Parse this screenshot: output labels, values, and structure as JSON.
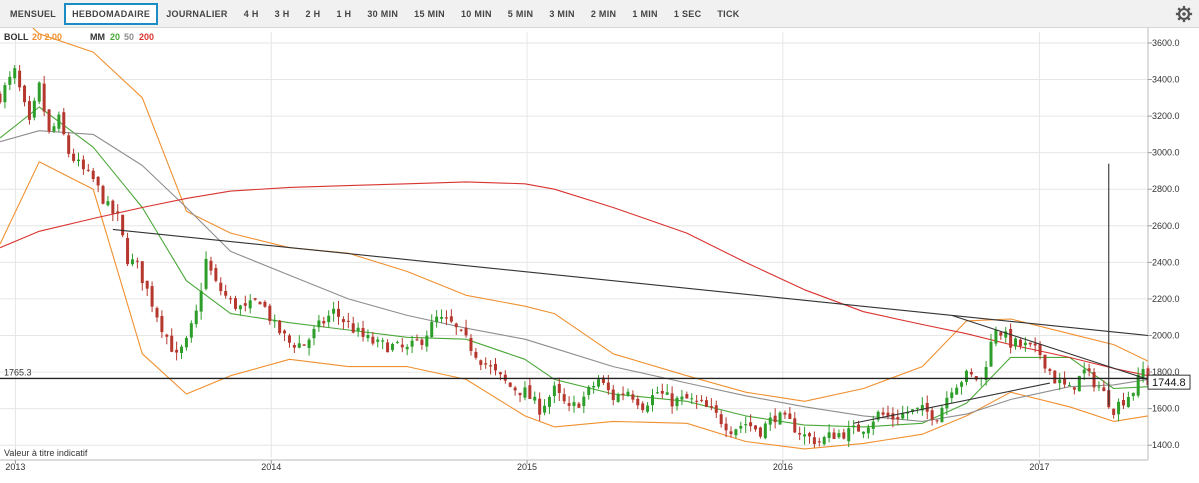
{
  "toolbar": {
    "timeframes": [
      "MENSUEL",
      "HEBDOMADAIRE",
      "JOURNALIER",
      "4 H",
      "3 H",
      "2 H",
      "1 H",
      "30 MIN",
      "15 MIN",
      "10 MIN",
      "5 MIN",
      "3 MIN",
      "2 MIN",
      "1 MIN",
      "1 SEC",
      "TICK"
    ],
    "active": "HEBDOMADAIRE"
  },
  "indicators": {
    "boll_label": "BOLL",
    "boll_params": "20 2.00",
    "mm_label": "MM",
    "mm_params": [
      "20",
      "50",
      "200"
    ]
  },
  "disclaimer": "Valeur à titre indicatif",
  "colors": {
    "up": "#2e9e2a",
    "down": "#b5372d",
    "boll": "#f0902f",
    "mm20": "#4aa838",
    "mm50": "#8e8e8e",
    "mm200": "#d9332f",
    "trendline": "#333333",
    "accent": "#1a8ec4"
  },
  "chart_data": {
    "type": "candlestick",
    "yaxis": {
      "ticks": [
        "3600.0",
        "3400.0",
        "3200.0",
        "3000.0",
        "2800.0",
        "2600.0",
        "2400.0",
        "2200.0",
        "2000.0",
        "1800.0",
        "1600.0",
        "1400.0"
      ],
      "range": [
        1330,
        3660
      ]
    },
    "xaxis": {
      "ticks": [
        "2013",
        "2014",
        "2015",
        "2016",
        "2017"
      ],
      "range": [
        "2012-12-10",
        "2017-06-05"
      ]
    },
    "hline_value": "1765.3",
    "last_price": "1744.8",
    "close_path": [
      [
        "2012-12-10",
        3310
      ],
      [
        "2012-12-31",
        3440
      ],
      [
        "2013-01-21",
        3150
      ],
      [
        "2013-02-04",
        3360
      ],
      [
        "2013-02-18",
        3100
      ],
      [
        "2013-03-04",
        3180
      ],
      [
        "2013-03-18",
        3000
      ],
      [
        "2013-04-08",
        2900
      ],
      [
        "2013-04-22",
        2850
      ],
      [
        "2013-05-13",
        2700
      ],
      [
        "2013-05-27",
        2640
      ],
      [
        "2013-06-10",
        2420
      ],
      [
        "2013-06-24",
        2380
      ],
      [
        "2013-07-15",
        2180
      ],
      [
        "2013-07-29",
        2050
      ],
      [
        "2013-08-19",
        1880
      ],
      [
        "2013-09-02",
        1960
      ],
      [
        "2013-09-16",
        2120
      ],
      [
        "2013-09-30",
        2410
      ],
      [
        "2013-10-14",
        2280
      ],
      [
        "2013-11-04",
        2180
      ],
      [
        "2013-11-25",
        2140
      ],
      [
        "2013-12-16",
        2200
      ],
      [
        "2014-01-06",
        2050
      ],
      [
        "2014-01-27",
        1960
      ],
      [
        "2014-02-17",
        1950
      ],
      [
        "2014-03-10",
        2050
      ],
      [
        "2014-03-31",
        2130
      ],
      [
        "2014-04-21",
        2060
      ],
      [
        "2014-05-12",
        1990
      ],
      [
        "2014-06-02",
        1950
      ],
      [
        "2014-06-23",
        1940
      ],
      [
        "2014-07-14",
        1920
      ],
      [
        "2014-08-04",
        1980
      ],
      [
        "2014-08-25",
        2090
      ],
      [
        "2014-09-15",
        2060
      ],
      [
        "2014-10-06",
        1970
      ],
      [
        "2014-10-27",
        1870
      ],
      [
        "2014-11-17",
        1790
      ],
      [
        "2014-12-08",
        1720
      ],
      [
        "2014-12-29",
        1690
      ],
      [
        "2015-01-19",
        1600
      ],
      [
        "2015-02-09",
        1700
      ],
      [
        "2015-03-02",
        1590
      ],
      [
        "2015-03-23",
        1660
      ],
      [
        "2015-04-13",
        1760
      ],
      [
        "2015-05-04",
        1660
      ],
      [
        "2015-05-25",
        1700
      ],
      [
        "2015-06-15",
        1620
      ],
      [
        "2015-07-06",
        1690
      ],
      [
        "2015-07-27",
        1640
      ],
      [
        "2015-08-17",
        1650
      ],
      [
        "2015-09-07",
        1620
      ],
      [
        "2015-09-28",
        1560
      ],
      [
        "2015-10-19",
        1490
      ],
      [
        "2015-11-09",
        1520
      ],
      [
        "2015-11-30",
        1480
      ],
      [
        "2015-12-21",
        1560
      ],
      [
        "2016-01-11",
        1520
      ],
      [
        "2016-02-01",
        1450
      ],
      [
        "2016-02-22",
        1420
      ],
      [
        "2016-03-14",
        1460
      ],
      [
        "2016-04-04",
        1470
      ],
      [
        "2016-04-25",
        1500
      ],
      [
        "2016-05-16",
        1570
      ],
      [
        "2016-06-06",
        1550
      ],
      [
        "2016-06-27",
        1580
      ],
      [
        "2016-07-18",
        1590
      ],
      [
        "2016-08-08",
        1560
      ],
      [
        "2016-08-29",
        1720
      ],
      [
        "2016-09-19",
        1780
      ],
      [
        "2016-10-10",
        1760
      ],
      [
        "2016-10-31",
        2050
      ],
      [
        "2016-11-21",
        1960
      ],
      [
        "2016-12-12",
        1940
      ],
      [
        "2017-01-02",
        1900
      ],
      [
        "2017-01-23",
        1760
      ],
      [
        "2017-02-13",
        1700
      ],
      [
        "2017-03-06",
        1800
      ],
      [
        "2017-03-27",
        1720
      ],
      [
        "2017-04-17",
        1600
      ],
      [
        "2017-05-01",
        1650
      ],
      [
        "2017-05-15",
        1700
      ],
      [
        "2017-05-29",
        1810
      ],
      [
        "2017-06-05",
        1745
      ]
    ],
    "series": [
      {
        "name": "BOLL",
        "values": [
          [
            "2012-12-10",
            3850
          ],
          [
            "2013-02-04",
            3650
          ],
          [
            "2013-04-22",
            3550
          ],
          [
            "2013-07-01",
            3300
          ],
          [
            "2013-09-02",
            2680
          ],
          [
            "2013-11-04",
            2560
          ],
          [
            "2014-01-27",
            2480
          ],
          [
            "2014-04-21",
            2450
          ],
          [
            "2014-07-14",
            2350
          ],
          [
            "2014-10-06",
            2220
          ],
          [
            "2014-12-29",
            2160
          ],
          [
            "2015-02-09",
            2120
          ],
          [
            "2015-05-04",
            1900
          ],
          [
            "2015-08-17",
            1780
          ],
          [
            "2015-11-09",
            1690
          ],
          [
            "2016-02-01",
            1640
          ],
          [
            "2016-04-25",
            1710
          ],
          [
            "2016-07-18",
            1830
          ],
          [
            "2016-09-19",
            2080
          ],
          [
            "2016-11-21",
            2090
          ],
          [
            "2017-02-13",
            2010
          ],
          [
            "2017-04-17",
            1950
          ],
          [
            "2017-06-05",
            1860
          ]
        ]
      },
      {
        "name": "BOLL",
        "values": [
          [
            "2012-12-10",
            2500
          ],
          [
            "2013-02-04",
            2950
          ],
          [
            "2013-04-22",
            2800
          ],
          [
            "2013-07-01",
            1900
          ],
          [
            "2013-09-02",
            1680
          ],
          [
            "2013-11-04",
            1780
          ],
          [
            "2014-01-27",
            1870
          ],
          [
            "2014-04-21",
            1830
          ],
          [
            "2014-07-14",
            1830
          ],
          [
            "2014-10-06",
            1760
          ],
          [
            "2014-12-29",
            1560
          ],
          [
            "2015-02-09",
            1500
          ],
          [
            "2015-05-04",
            1530
          ],
          [
            "2015-08-17",
            1520
          ],
          [
            "2015-11-09",
            1420
          ],
          [
            "2016-02-01",
            1380
          ],
          [
            "2016-04-25",
            1410
          ],
          [
            "2016-07-18",
            1460
          ],
          [
            "2016-09-19",
            1560
          ],
          [
            "2016-11-21",
            1690
          ],
          [
            "2017-02-13",
            1610
          ],
          [
            "2017-04-17",
            1530
          ],
          [
            "2017-06-05",
            1560
          ]
        ]
      },
      {
        "name": "MM",
        "values": [
          [
            "2012-12-10",
            3080
          ],
          [
            "2013-02-04",
            3250
          ],
          [
            "2013-04-22",
            3030
          ],
          [
            "2013-07-01",
            2700
          ],
          [
            "2013-09-02",
            2300
          ],
          [
            "2013-11-04",
            2120
          ],
          [
            "2014-01-27",
            2070
          ],
          [
            "2014-04-21",
            2030
          ],
          [
            "2014-07-14",
            1990
          ],
          [
            "2014-10-06",
            1980
          ],
          [
            "2014-12-29",
            1870
          ],
          [
            "2015-02-09",
            1760
          ],
          [
            "2015-05-04",
            1680
          ],
          [
            "2015-08-17",
            1640
          ],
          [
            "2015-11-09",
            1560
          ],
          [
            "2016-02-01",
            1510
          ],
          [
            "2016-04-25",
            1500
          ],
          [
            "2016-07-18",
            1520
          ],
          [
            "2016-09-19",
            1630
          ],
          [
            "2016-11-21",
            1880
          ],
          [
            "2017-02-13",
            1880
          ],
          [
            "2017-04-17",
            1710
          ],
          [
            "2017-06-05",
            1720
          ]
        ]
      },
      {
        "name": "MM",
        "values": [
          [
            "2012-12-10",
            3060
          ],
          [
            "2013-02-04",
            3120
          ],
          [
            "2013-04-22",
            3100
          ],
          [
            "2013-07-01",
            2930
          ],
          [
            "2013-09-02",
            2700
          ],
          [
            "2013-11-04",
            2460
          ],
          [
            "2014-01-27",
            2330
          ],
          [
            "2014-04-21",
            2200
          ],
          [
            "2014-07-14",
            2110
          ],
          [
            "2014-10-06",
            2040
          ],
          [
            "2014-12-29",
            1980
          ],
          [
            "2015-02-09",
            1930
          ],
          [
            "2015-05-04",
            1830
          ],
          [
            "2015-08-17",
            1740
          ],
          [
            "2015-11-09",
            1670
          ],
          [
            "2016-02-01",
            1610
          ],
          [
            "2016-04-25",
            1560
          ],
          [
            "2016-07-18",
            1530
          ],
          [
            "2016-09-19",
            1570
          ],
          [
            "2016-11-21",
            1650
          ],
          [
            "2017-02-13",
            1720
          ],
          [
            "2017-04-17",
            1730
          ],
          [
            "2017-06-05",
            1760
          ]
        ]
      },
      {
        "name": "MM",
        "values": [
          [
            "2012-12-10",
            2480
          ],
          [
            "2013-02-04",
            2570
          ],
          [
            "2013-04-22",
            2640
          ],
          [
            "2013-07-01",
            2700
          ],
          [
            "2013-09-02",
            2750
          ],
          [
            "2013-11-04",
            2790
          ],
          [
            "2014-01-27",
            2810
          ],
          [
            "2014-04-21",
            2820
          ],
          [
            "2014-07-14",
            2830
          ],
          [
            "2014-10-06",
            2840
          ],
          [
            "2014-12-29",
            2830
          ],
          [
            "2015-02-09",
            2800
          ],
          [
            "2015-05-04",
            2700
          ],
          [
            "2015-08-17",
            2560
          ],
          [
            "2015-11-09",
            2400
          ],
          [
            "2016-02-01",
            2250
          ],
          [
            "2016-04-25",
            2130
          ],
          [
            "2016-07-18",
            2060
          ],
          [
            "2016-09-19",
            2010
          ],
          [
            "2016-11-21",
            1950
          ],
          [
            "2017-02-13",
            1880
          ],
          [
            "2017-04-17",
            1820
          ],
          [
            "2017-06-05",
            1780
          ]
        ]
      }
    ],
    "trendlines": [
      [
        [
          "2013-05-20",
          2580
        ],
        [
          "2017-06-05",
          2000
        ]
      ],
      [
        [
          "2016-04-11",
          1520
        ],
        [
          "2017-01-16",
          1740
        ]
      ],
      [
        [
          "2016-08-29",
          2110
        ],
        [
          "2017-06-05",
          1760
        ]
      ],
      [
        [
          "2017-04-10",
          1620
        ],
        [
          "2017-04-10",
          2940
        ]
      ]
    ]
  }
}
